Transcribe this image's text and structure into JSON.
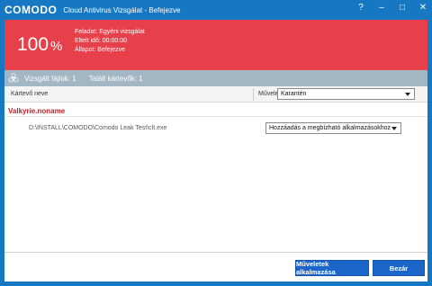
{
  "window": {
    "brand": "COMODO",
    "title": "Cloud Antivirus Vizsgálat - Befejezve",
    "buttons": {
      "help": "?",
      "minimize": "–",
      "maximize": "□",
      "close": "✕"
    }
  },
  "status": {
    "percent": "100",
    "percent_sign": "%",
    "task": "Feladat: Egyéni vizsgálat",
    "elapsed": "Eltelt idő: 00:00:00",
    "state": "Állapot: Befejezve",
    "background_color": "#e7404b"
  },
  "summary": {
    "scanned": "Vizsgált fájlok:  1",
    "threats": "Talált kártevők:  1"
  },
  "table": {
    "col_name": "Kártevő neve",
    "col_action": "Művelet",
    "action_all_selected": "Karantén"
  },
  "threats": [
    {
      "name": "Valkyrie.noname",
      "path": "D:\\INSTALL\\COMODO\\Comodo Leak Test\\clt.exe",
      "action_selected": "Hozzáadás a megbízható alkalmazásokhoz"
    }
  ],
  "footer": {
    "apply_label": "Műveletek alkalmazása",
    "close_label": "Bezár"
  },
  "colors": {
    "titlebar": "#1678c2",
    "accent_button": "#1d66c9",
    "threat_text": "#c0202a",
    "summary_bar": "#a3b6c3"
  }
}
